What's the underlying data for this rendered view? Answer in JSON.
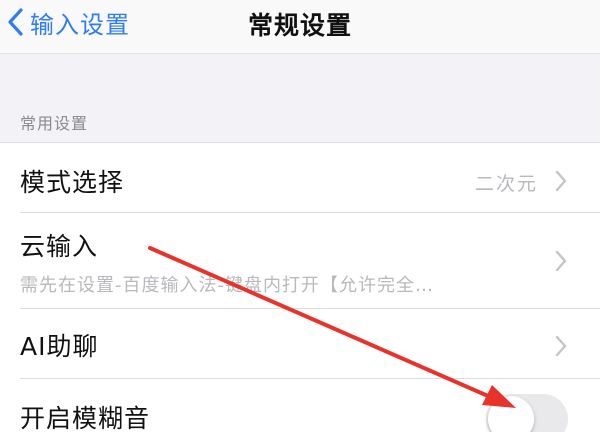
{
  "navbar": {
    "back_label": "输入设置",
    "title": "常规设置"
  },
  "section": {
    "header": "常用设置"
  },
  "rows": [
    {
      "label": "模式选择",
      "value": "二次元"
    },
    {
      "label": "云输入",
      "subtitle": "需先在设置-百度输入法-键盘内打开【允许完全…"
    },
    {
      "label": "AI助聊"
    },
    {
      "label": "开启模糊音",
      "toggle_on": false
    }
  ],
  "icons": {
    "back": "chevron-left-icon",
    "disclosure": "chevron-right-icon"
  },
  "colors": {
    "accent": "#2f7cf6",
    "annotation_arrow": "#e8322c",
    "toggle_off": "#e9e9eb"
  }
}
